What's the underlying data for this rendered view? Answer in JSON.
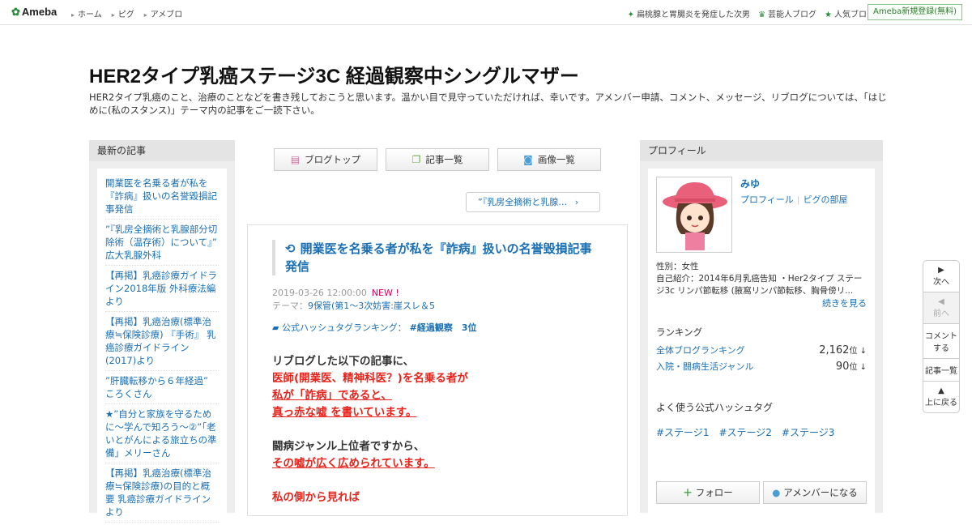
{
  "header": {
    "logo": "Ameba",
    "nav": [
      "ホーム",
      "ピグ",
      "アメブロ"
    ],
    "right": [
      "扁桃腺と胃腸炎を発症した次男",
      "芸能人ブログ",
      "人気ブログ"
    ],
    "signup": "Ameba新規登録(無料)"
  },
  "blog": {
    "title": "HER2タイプ乳癌ステージ3C 経過観察中シングルマザー",
    "description": "HER2タイプ乳癌のこと、治療のことなどを書き残しておこうと思います。温かい目で見守っていただければ、幸いです。アメンバー申請、コメント、メッセージ、リブログについては、「はじめに(私のスタンス)」テーマ内の記事をご一読下さい。"
  },
  "left": {
    "heading": "最新の記事",
    "items": [
      "開業医を名乗る者が私を『詐病』扱いの名誉毀損記事発信",
      "”『乳房全摘術と乳腺部分切除術（温存術）について』” 広大乳腺外科",
      "【再掲】乳癌診療ガイドライン2018年版 外科療法編より",
      "【再掲】乳癌治療(標準治療≒保険診療) 『手術』 乳癌診療ガイドライン(2017)より",
      "”肝臓転移から６年経過” ころくさん",
      "★”自分と家族を守るために～学んで知ろう～②”「老いとがんによる旅立ちの準備」メリーさん",
      "【再掲】乳癌治療(標準治療≒保険診療)の目的と概要 乳癌診療ガイドラインより"
    ]
  },
  "buttons": [
    "ブログトップ",
    "記事一覧",
    "画像一覧"
  ],
  "next_label": "”『乳房全摘術と乳腺…",
  "article": {
    "title": "開業医を名乗る者が私を『詐病』扱いの名誉毀損記事発信",
    "date": "2019-03-26 12:00:00",
    "new": "NEW !",
    "theme_label": "テーマ：",
    "theme": "9保管(第1～3次妨害:崖スレ＆5",
    "hash_label": "公式ハッシュタグランキング：",
    "hash_tag": "#経過観察　3位",
    "lines": [
      "リブログした以下の記事に、",
      "医師(開業医、精神科医？)を名乗る者が",
      "私が「詐病」であると、",
      "真っ赤な嘘 を書いています。",
      "",
      "闘病ジャンル上位者ですから、",
      "その嘘が広く広められています。",
      "",
      "私の側から見れば"
    ]
  },
  "right": {
    "heading": "プロフィール",
    "name": "みゆ",
    "links": [
      "プロフィール",
      "ピグの部屋"
    ],
    "gender": "性別：女性",
    "intro": "自己紹介：2014年6月乳癌告知 ・Her2タイプ ステージ3c リンパ節転移 (腋窩リンパ節転移、胸骨傍リ...",
    "more": "続きを見る",
    "rank_heading": "ランキング",
    "ranks": [
      {
        "label": "全体ブログランキング",
        "value": "2,162",
        "unit": "位 ↓"
      },
      {
        "label": "入院・闘病生活ジャンル",
        "value": "90",
        "unit": "位 ↓"
      }
    ],
    "tags_heading": "よく使う公式ハッシュタグ",
    "tags": [
      "#ステージ1",
      "#ステージ2",
      "#ステージ3"
    ],
    "follow": "フォロー",
    "amember": "アメンバーになる"
  },
  "side": [
    "次へ",
    "前へ",
    "コメントする",
    "記事一覧",
    "上に戻る"
  ]
}
